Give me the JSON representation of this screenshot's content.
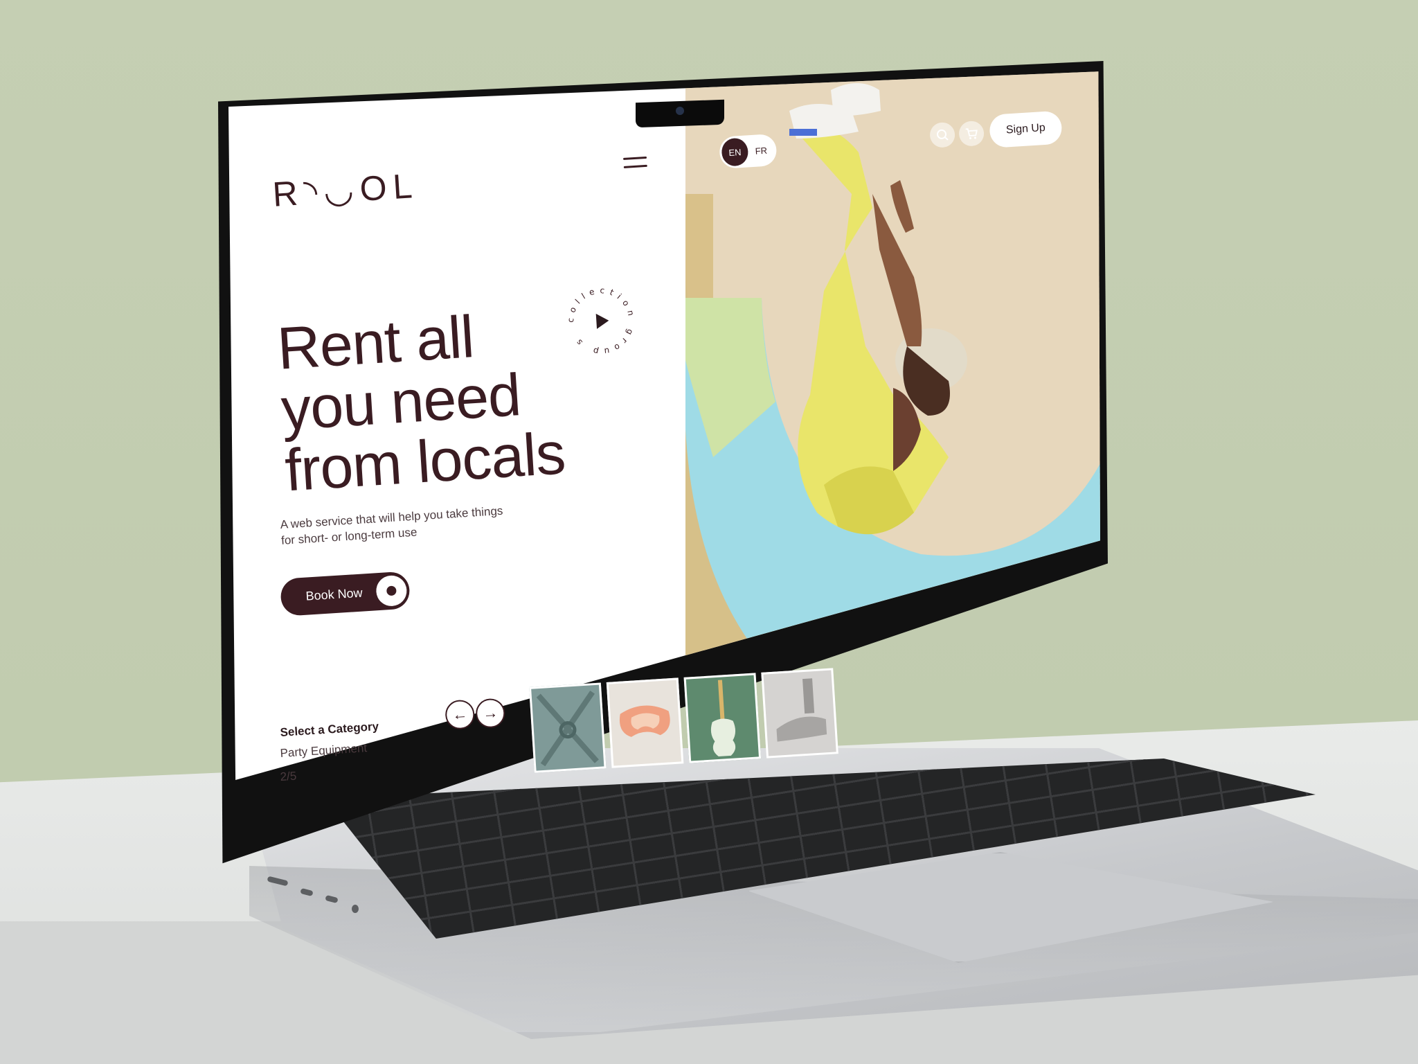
{
  "site": {
    "logo": "R◝◡OL",
    "hero": {
      "line1": "Rent all",
      "line2": "you need",
      "line3": "from locals",
      "subtitle": "A web service that will help you take things for short- or long-term use",
      "cta_label": "Book Now"
    },
    "badge": {
      "circular_text": "collection group s"
    },
    "category": {
      "title": "Select a Category",
      "value": "Party Equipment",
      "page": "2/5"
    },
    "language": {
      "options": [
        "EN",
        "FR"
      ],
      "active": "EN"
    },
    "header": {
      "signup_label": "Sign Up"
    },
    "thumbnails": [
      {
        "name": "chair",
        "color": "#7f9a98"
      },
      {
        "name": "ski-goggles",
        "color": "#e8e3dc"
      },
      {
        "name": "guitar",
        "color": "#5e8a6e"
      },
      {
        "name": "vacuum",
        "color": "#d5d3d1"
      }
    ],
    "icons": {
      "menu": "menu-icon",
      "play": "play-icon",
      "prev": "arrow-left-icon",
      "next": "arrow-right-icon",
      "search": "search-icon",
      "cart": "cart-icon"
    },
    "colors": {
      "brand": "#3a1c22",
      "background": "#ffffff",
      "scene_wall": "#c4cdb2",
      "photo_beige": "#e7d7bc",
      "photo_blue": "#9fdbe6",
      "photo_yellow": "#e9e56a"
    }
  }
}
